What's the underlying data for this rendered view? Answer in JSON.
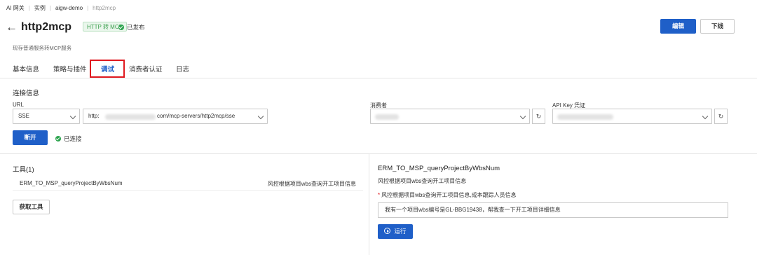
{
  "breadcrumb": [
    "AI 网关",
    "实例",
    "aigw-demo",
    "http2mcp"
  ],
  "header": {
    "title": "http2mcp",
    "tag": "HTTP 转 MCP",
    "status": "已发布",
    "edit_label": "编辑",
    "offline_label": "下线",
    "subtitle": "现存普通服务转MCP服务"
  },
  "tabs": [
    {
      "label": "基本信息",
      "active": false
    },
    {
      "label": "策略与插件",
      "active": false
    },
    {
      "label": "调试",
      "active": true
    },
    {
      "label": "消费者认证",
      "active": false
    },
    {
      "label": "日志",
      "active": false
    }
  ],
  "connection": {
    "section_title": "连接信息",
    "url_label": "URL",
    "protocol": "SSE",
    "url_prefix": "http:",
    "url_suffix": "com/mcp-servers/http2mcp/sse",
    "consumer_label": "消费者",
    "apikey_label": "API Key 凭证",
    "disconnect_label": "断开",
    "connected_status": "已连接"
  },
  "tools": {
    "title": "工具(1)",
    "items": [
      {
        "name": "ERM_TO_MSP_queryProjectByWbsNum",
        "description": "风控根据项目wbs查询开工项目信息"
      }
    ],
    "fetch_label": "获取工具"
  },
  "detail": {
    "tool_name": "ERM_TO_MSP_queryProjectByWbsNum",
    "tool_description": "风控根据项目wbs查询开工项目信息",
    "param_label": "风控根据项目wbs查询开工项目信息,成本跟踪人员信息",
    "param_value": "我有一个项目wbs编号是GL-BBG19438，帮我查一下开工项目详细信息",
    "run_label": "运行"
  },
  "colors": {
    "primary": "#1f5fc8",
    "success": "#2ea44f",
    "highlight": "#e0191f"
  }
}
